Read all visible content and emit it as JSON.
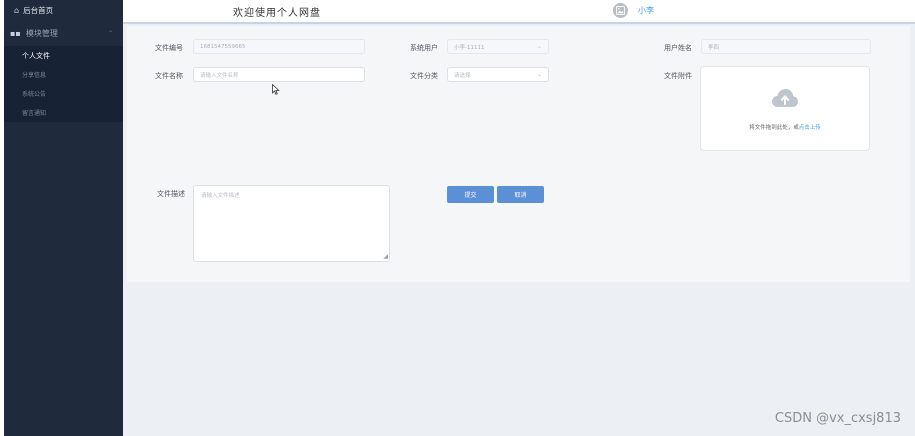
{
  "sidebar": {
    "home": "后台首页",
    "group": "模块管理",
    "items": [
      {
        "label": "个人文件"
      },
      {
        "label": "分享信息"
      },
      {
        "label": "系统公告"
      },
      {
        "label": "留言通知"
      }
    ]
  },
  "header": {
    "title": "欢迎使用个人网盘",
    "username": "小李"
  },
  "form": {
    "file_no_label": "文件编号",
    "file_no_value": "1681547559665",
    "sys_user_label": "系统用户",
    "sys_user_value": "小李-11111",
    "user_name_label": "用户姓名",
    "user_name_value": "李四",
    "file_name_label": "文件名称",
    "file_name_placeholder": "请输入文件名称",
    "file_category_label": "文件分类",
    "file_category_placeholder": "请选择",
    "attachment_label": "文件附件",
    "upload_tip": "将文件拖到此处，或",
    "upload_link": "点击上传",
    "desc_label": "文件描述",
    "desc_placeholder": "请输入文件描述",
    "submit": "提交",
    "cancel": "取消"
  },
  "watermark": "CSDN @vx_cxsj813",
  "colors": {
    "sidebar_bg": "#1f2a3d",
    "accent": "#409eff",
    "button": "#5b8fd6"
  }
}
